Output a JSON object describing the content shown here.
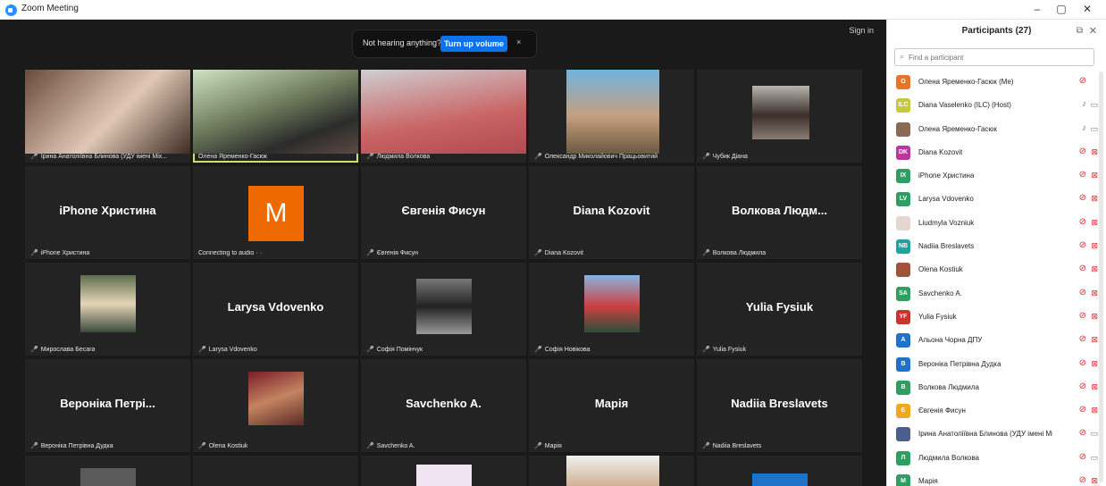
{
  "window": {
    "title": "Zoom Meeting",
    "minimize": "–",
    "maximize": "▢",
    "close": "✕"
  },
  "meeting": {
    "signin": "Sign in",
    "notice": {
      "text": "Not hearing anything?",
      "button": "Turn up volume",
      "close": "×"
    },
    "tiles": [
      {
        "label": "Ірина Анатоліївна Блинова (УДУ імені Міх...",
        "muted": true,
        "video": true
      },
      {
        "label": "Олена Яременко-Гасюк",
        "muted": false,
        "video": true,
        "active": true
      },
      {
        "label": "Людмила Волкова",
        "muted": true,
        "video": true
      },
      {
        "label": "Олександр Миколайович Працьовитий",
        "muted": true,
        "video": true
      },
      {
        "label": "Чубик Діана",
        "muted": true,
        "video": true
      },
      {
        "label": "iPhone Христина",
        "muted": true,
        "name": "iPhone Христина"
      },
      {
        "label": "Connecting to audio ·˙·",
        "muted": false,
        "avatarLetter": "M"
      },
      {
        "label": "Євгенія Фисун",
        "muted": true,
        "name": "Євгенія Фисун"
      },
      {
        "label": "Diana Kozovit",
        "muted": true,
        "name": "Diana Kozovit"
      },
      {
        "label": "Волкова Людмила",
        "muted": true,
        "name": "Волкова Людм..."
      },
      {
        "label": "Мирослава Бесага",
        "muted": true,
        "video": true
      },
      {
        "label": "Larysa Vdovenko",
        "muted": true,
        "name": "Larysa Vdovenko"
      },
      {
        "label": "Софія Помінчук",
        "muted": true,
        "video": true
      },
      {
        "label": "Софія Новікова",
        "muted": true,
        "video": true
      },
      {
        "label": "Yulia Fysiuk",
        "muted": true,
        "name": "Yulia Fysiuk"
      },
      {
        "label": "Вероніка Петрівна Дудка",
        "muted": true,
        "name": "Вероніка Петрі..."
      },
      {
        "label": "Olena Kostiuk",
        "muted": true,
        "video": true
      },
      {
        "label": "Savchenko  A.",
        "muted": true,
        "name": "Savchenko  A."
      },
      {
        "label": "Марія",
        "muted": true,
        "name": "Марія"
      },
      {
        "label": "Nadiia Breslavets",
        "muted": true,
        "name": "Nadiia Breslavets"
      },
      {
        "label": "",
        "muted": false,
        "video": true
      },
      {
        "label": "",
        "muted": false
      },
      {
        "label": "",
        "muted": false,
        "video": true
      },
      {
        "label": "",
        "muted": false,
        "video": true
      },
      {
        "label": "",
        "muted": false,
        "video": true
      }
    ]
  },
  "sidebar": {
    "title": "Participants (27)",
    "popout": "⧉",
    "close": "✕",
    "search_placeholder": "Find a participant",
    "participants": [
      {
        "name": "Олена Яременко-Гасюк (Me)",
        "initials": "О",
        "color": "#e8742a",
        "mic": "muted",
        "cam": ""
      },
      {
        "name": "Diana Vaselenko (ILC) (Host)",
        "initials": "ILC",
        "color": "#c5c93a",
        "mic": "on",
        "cam": "on"
      },
      {
        "name": "Олена Яременко-Гасюк",
        "initials": "",
        "color": "#8a6a52",
        "mic": "on",
        "cam": "on"
      },
      {
        "name": "Diana Kozovit",
        "initials": "DK",
        "color": "#b8399c",
        "mic": "muted",
        "cam": "off"
      },
      {
        "name": "iPhone Христина",
        "initials": "IX",
        "color": "#2f9e63",
        "mic": "muted",
        "cam": "off"
      },
      {
        "name": "Larysa Vdovenko",
        "initials": "LV",
        "color": "#2f9e63",
        "mic": "muted",
        "cam": "off"
      },
      {
        "name": "Liudmyla Vozniuk",
        "initials": "",
        "color": "#e5d6cf",
        "mic": "muted",
        "cam": "off"
      },
      {
        "name": "Nadiia Breslavets",
        "initials": "NB",
        "color": "#1fa39e",
        "mic": "muted",
        "cam": "off"
      },
      {
        "name": "Olena Kostiuk",
        "initials": "",
        "color": "#a0523a",
        "mic": "muted",
        "cam": "off"
      },
      {
        "name": "Savchenko  A.",
        "initials": "SA",
        "color": "#2f9e63",
        "mic": "muted",
        "cam": "off"
      },
      {
        "name": "Yulia Fysiuk",
        "initials": "YF",
        "color": "#c8352e",
        "mic": "muted",
        "cam": "off"
      },
      {
        "name": "Альона Чорна ДПУ",
        "initials": "А",
        "color": "#1e72c8",
        "mic": "muted",
        "cam": "off"
      },
      {
        "name": "Вероніка Петрівна Дудка",
        "initials": "В",
        "color": "#1e72c8",
        "mic": "muted",
        "cam": "off"
      },
      {
        "name": "Волкова Людмила",
        "initials": "В",
        "color": "#2f9e63",
        "mic": "muted",
        "cam": "off"
      },
      {
        "name": "Євгенія Фисун",
        "initials": "Є",
        "color": "#f0a81f",
        "mic": "muted",
        "cam": "off"
      },
      {
        "name": "Ірина Анатоліївна Блинова (УДУ імені Ми...",
        "initials": "",
        "color": "#4b5f8a",
        "mic": "muted",
        "cam": "on"
      },
      {
        "name": "Людмила Волкова",
        "initials": "Л",
        "color": "#2f9e63",
        "mic": "muted",
        "cam": "on"
      },
      {
        "name": "Марія",
        "initials": "М",
        "color": "#2f9e63",
        "mic": "muted",
        "cam": "off"
      }
    ]
  }
}
